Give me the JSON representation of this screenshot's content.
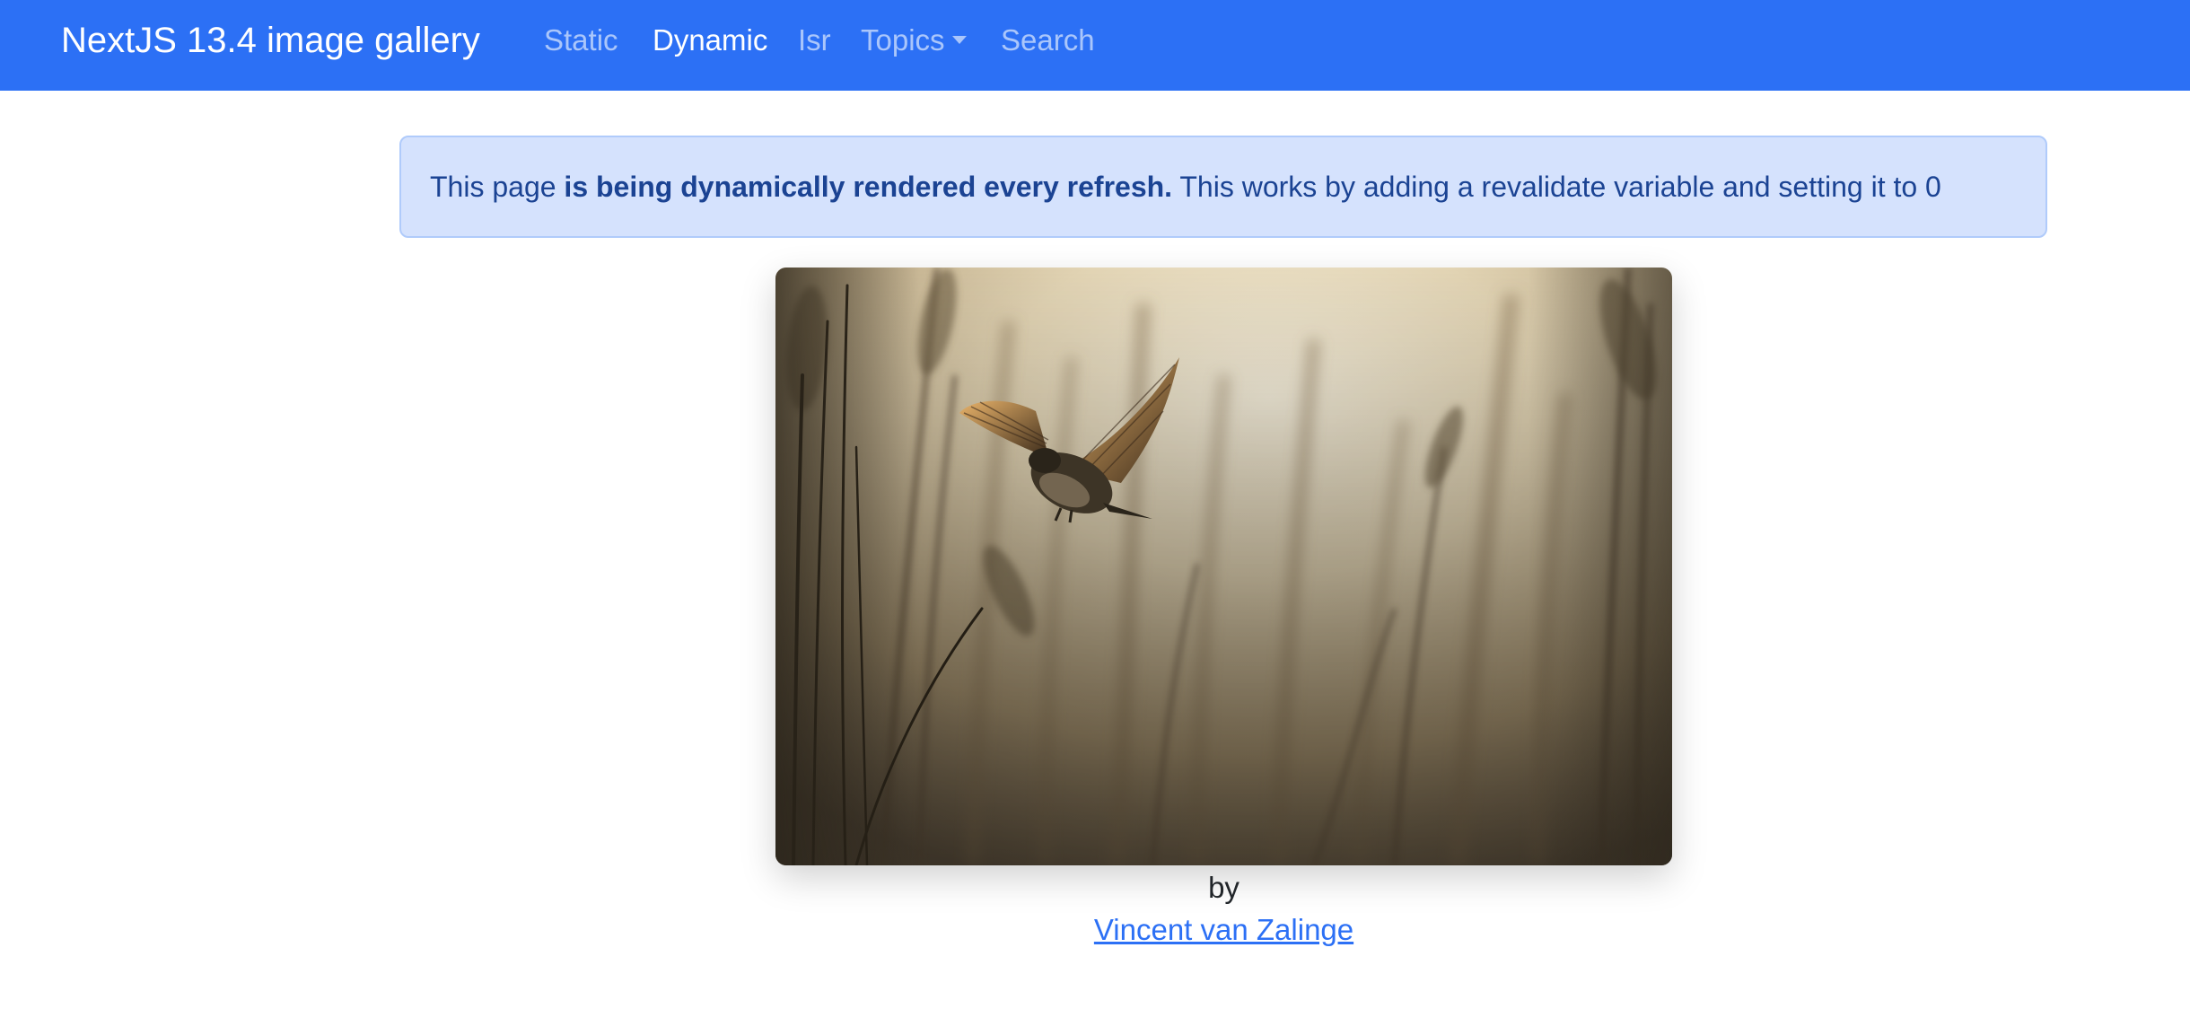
{
  "navbar": {
    "brand": "NextJS 13.4 image gallery",
    "links": [
      {
        "label": "Static"
      },
      {
        "label": "Dynamic"
      },
      {
        "label": "Isr"
      },
      {
        "label": "Topics"
      },
      {
        "label": "Search"
      }
    ],
    "active": "Dynamic",
    "background": "#2c70f5"
  },
  "alert": {
    "prefix": "This page ",
    "emphasis": "is being dynamically rendered every refresh.",
    "suffix": " This works by adding a revalidate variable and setting it to 0"
  },
  "photo": {
    "subject": "bird in flight among reeds"
  },
  "credit": {
    "by": "by",
    "author": "Vincent van Zalinge"
  }
}
